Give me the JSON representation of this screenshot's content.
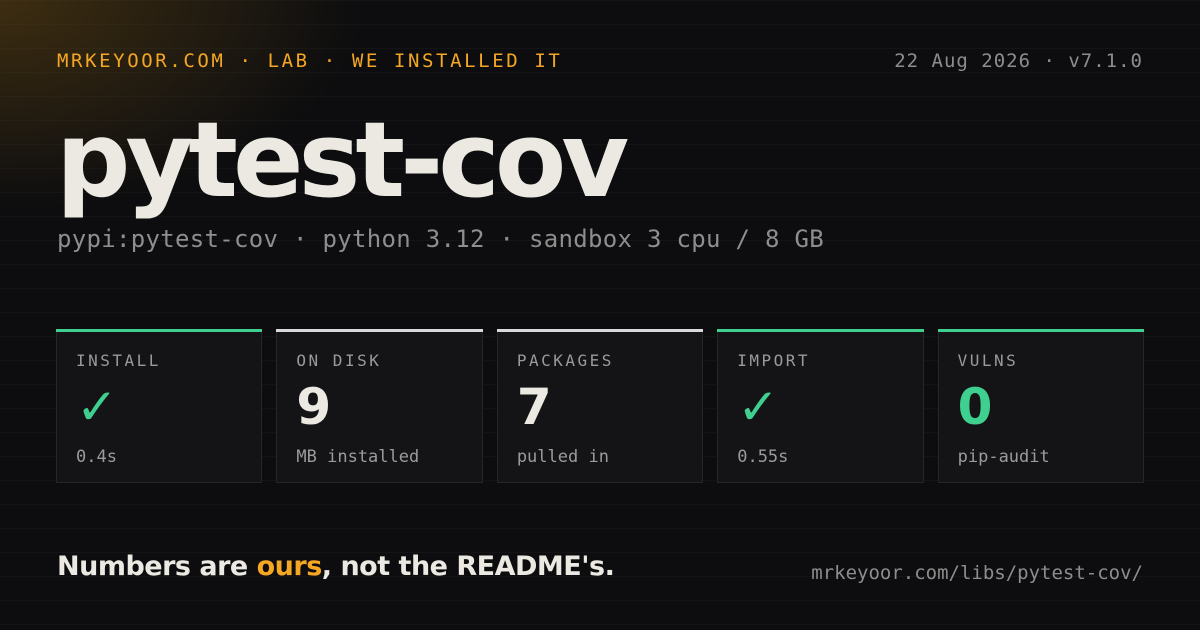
{
  "header": {
    "kicker": "MRKEYOOR.COM · LAB · WE INSTALLED IT",
    "meta": "22 Aug 2026 · v7.1.0"
  },
  "package": {
    "name": "pytest-cov",
    "details": "pypi:pytest-cov · python 3.12 · sandbox 3 cpu / 8 GB"
  },
  "stats": [
    {
      "label": "INSTALL",
      "value": "✓",
      "note": "0.4s",
      "accent": "#3fcf8e",
      "value_color": "#3fcf8e"
    },
    {
      "label": "ON DISK",
      "value": "9",
      "note": "MB installed",
      "accent": "#d9d9d9",
      "value_color": "#ebe9e2"
    },
    {
      "label": "PACKAGES",
      "value": "7",
      "note": "pulled in",
      "accent": "#d9d9d9",
      "value_color": "#ebe9e2"
    },
    {
      "label": "IMPORT",
      "value": "✓",
      "note": "0.55s",
      "accent": "#3fcf8e",
      "value_color": "#3fcf8e"
    },
    {
      "label": "VULNS",
      "value": "0",
      "note": "pip-audit",
      "accent": "#3fcf8e",
      "value_color": "#3fcf8e"
    }
  ],
  "footer": {
    "tagline_start": "Numbers are ",
    "tagline_accent": "ours",
    "tagline_end": ", not the README's.",
    "url": "mrkeyoor.com/libs/pytest-cov/"
  },
  "colors": {
    "brand": "#f5a623",
    "success": "#3fcf8e",
    "background": "#0d0d0f"
  }
}
